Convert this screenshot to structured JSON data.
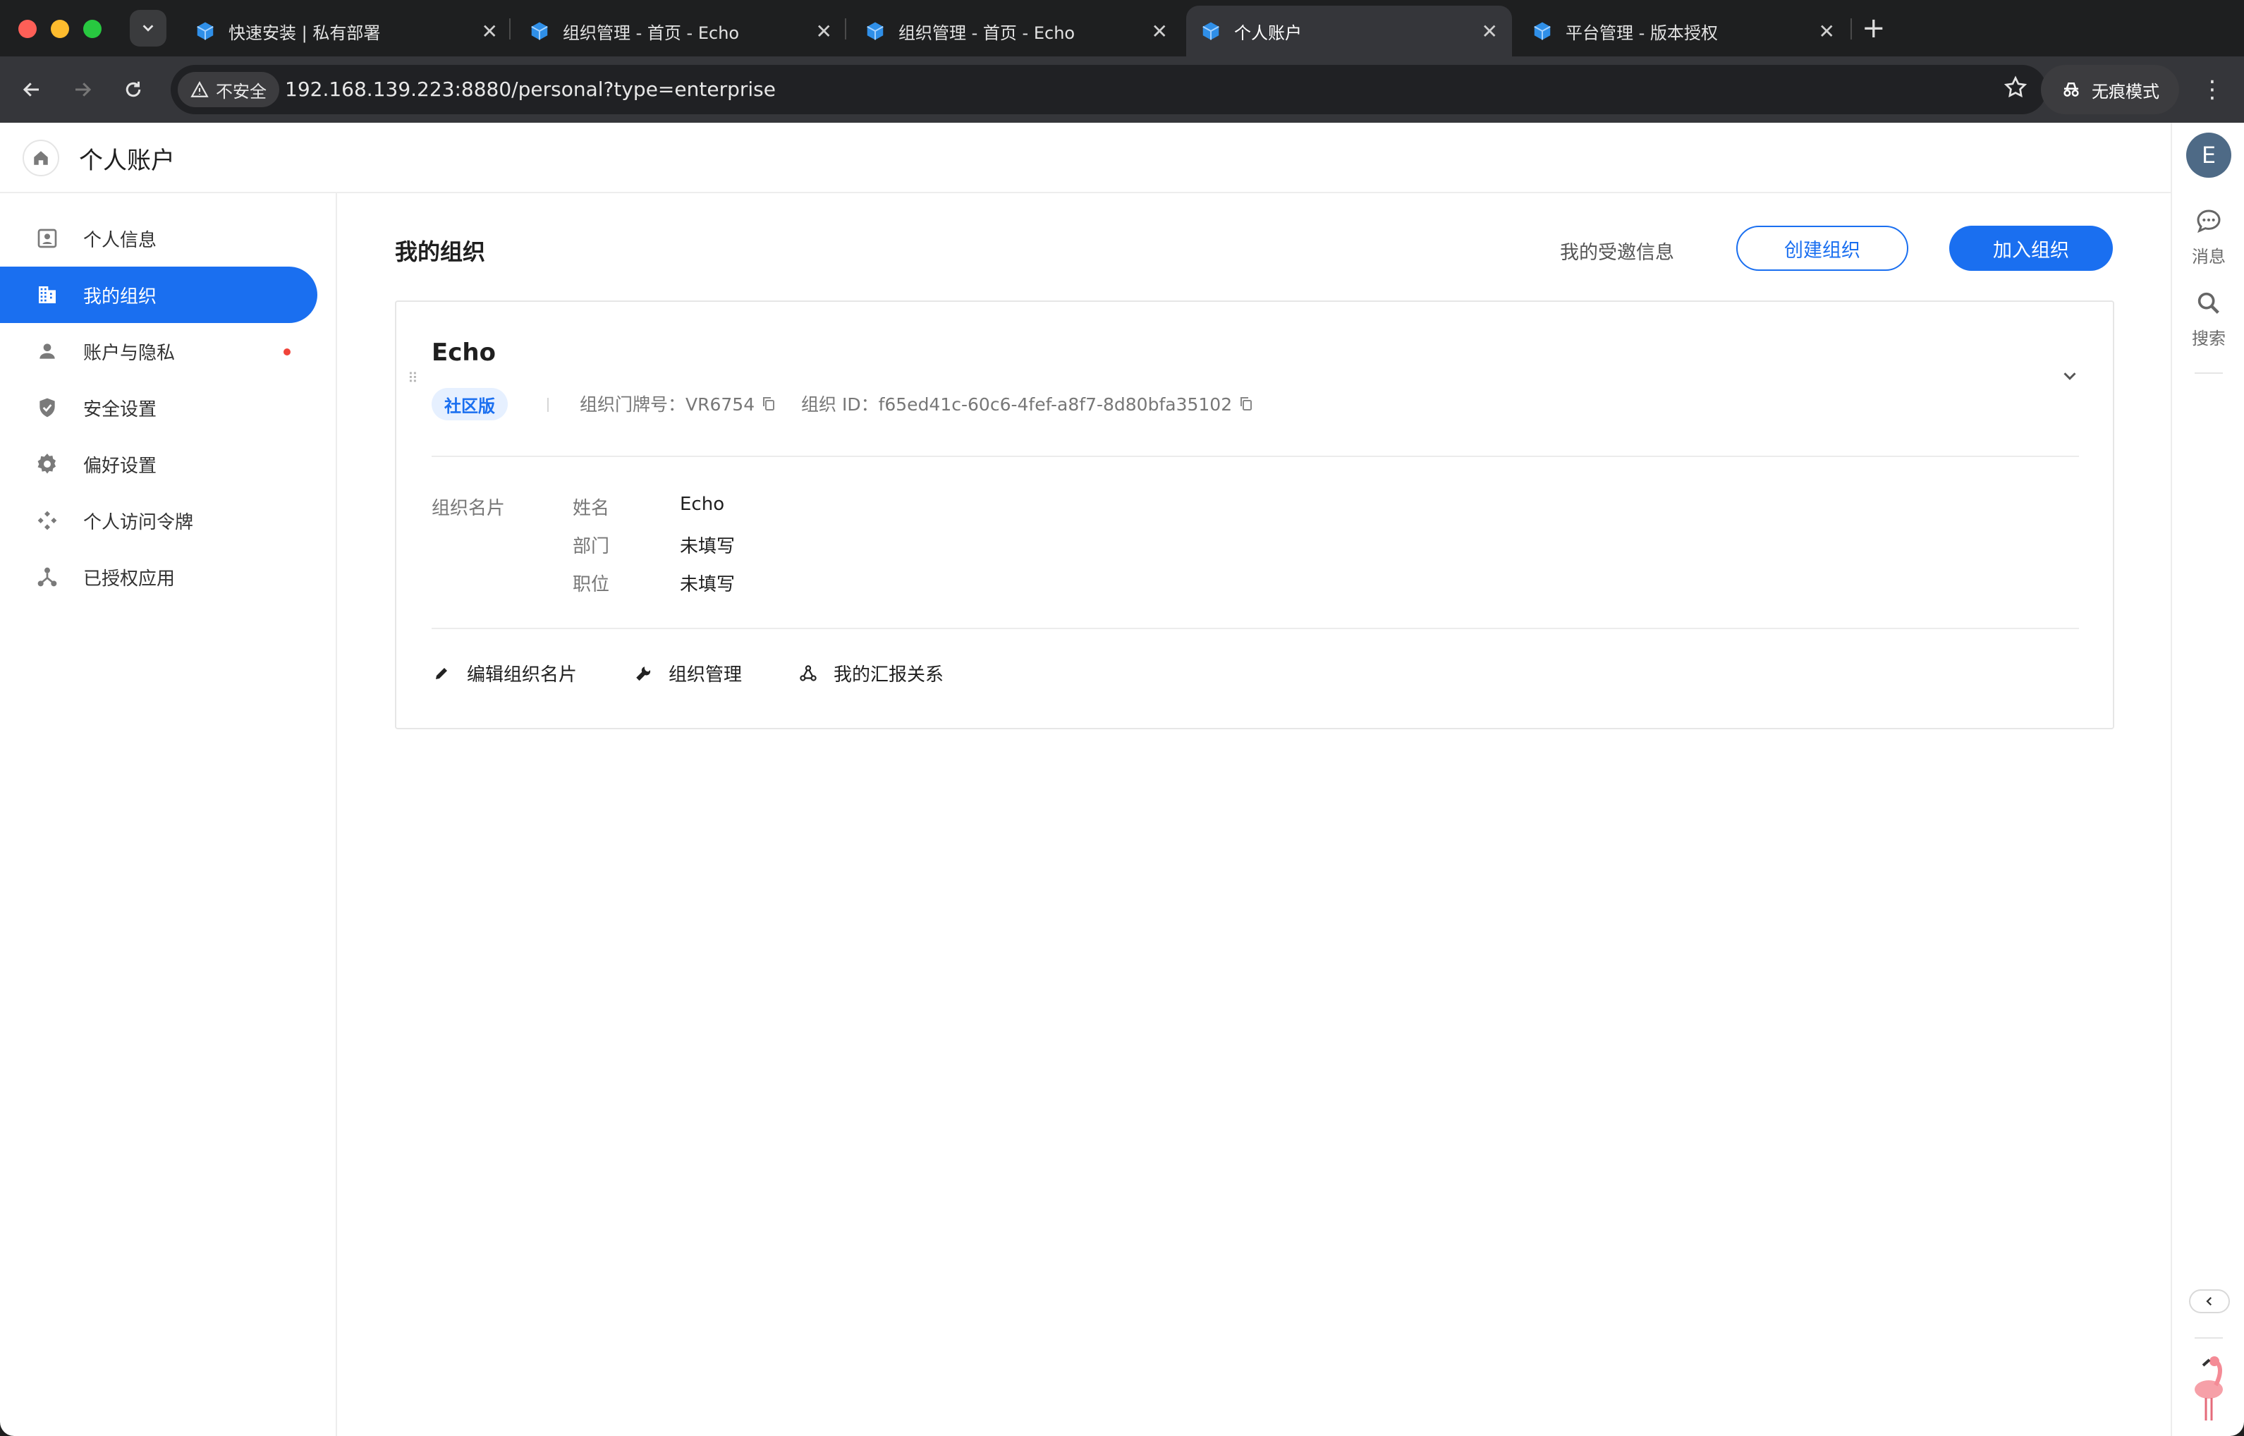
{
  "browser": {
    "tabs": [
      {
        "title": "快速安装 | 私有部署",
        "active": false
      },
      {
        "title": "组织管理 - 首页 - Echo",
        "active": false
      },
      {
        "title": "组织管理 - 首页 - Echo",
        "active": false
      },
      {
        "title": "个人账户",
        "active": true
      },
      {
        "title": "平台管理 - 版本授权",
        "active": false
      }
    ],
    "security_label": "不安全",
    "url": "192.168.139.223:8880/personal?type=enterprise",
    "incognito_label": "无痕模式"
  },
  "header": {
    "title": "个人账户",
    "avatar_letter": "E"
  },
  "rail": {
    "messages_label": "消息",
    "search_label": "搜索"
  },
  "sidebar": {
    "items": [
      {
        "label": "个人信息",
        "icon": "contact-card-icon"
      },
      {
        "label": "我的组织",
        "icon": "building-icon",
        "active": true
      },
      {
        "label": "账户与隐私",
        "icon": "person-icon",
        "has_dot": true
      },
      {
        "label": "安全设置",
        "icon": "shield-check-icon"
      },
      {
        "label": "偏好设置",
        "icon": "gear-icon"
      },
      {
        "label": "个人访问令牌",
        "icon": "token-icon"
      },
      {
        "label": "已授权应用",
        "icon": "app-branch-icon"
      }
    ]
  },
  "main": {
    "section_title": "我的组织",
    "invite_link": "我的受邀信息",
    "create_button": "创建组织",
    "join_button": "加入组织",
    "org": {
      "name": "Echo",
      "edition_badge": "社区版",
      "door_number": "组织门牌号：VR6754",
      "org_id": "组织 ID：f65ed41c-60c6-4fef-a8f7-8d80bfa35102",
      "card_label": "组织名片",
      "fields": [
        {
          "key": "姓名",
          "value": "Echo"
        },
        {
          "key": "部门",
          "value": "未填写"
        },
        {
          "key": "职位",
          "value": "未填写"
        }
      ],
      "actions": [
        {
          "label": "编辑组织名片",
          "icon": "pencil-icon"
        },
        {
          "label": "组织管理",
          "icon": "wrench-icon"
        },
        {
          "label": "我的汇报关系",
          "icon": "hierarchy-icon"
        }
      ]
    }
  },
  "colors": {
    "accent": "#1a6ff0",
    "badge_bg": "#e6f0ff",
    "alert_dot": "#f0443a"
  }
}
